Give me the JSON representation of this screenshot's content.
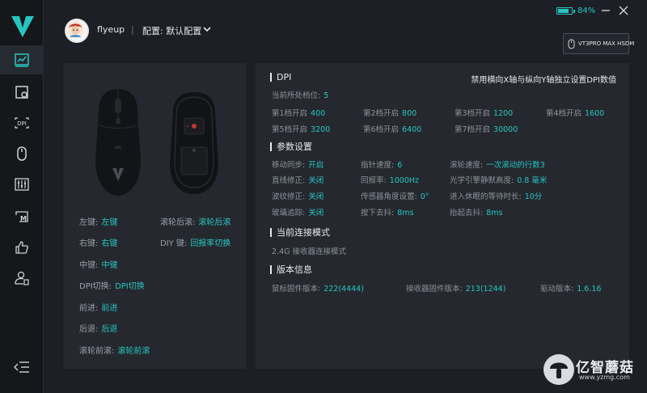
{
  "sidebar": {
    "items": [
      {
        "icon": "chart-icon",
        "active": true
      },
      {
        "icon": "macro-settings-icon",
        "active": false
      },
      {
        "icon": "dpi-icon",
        "label": "DPI",
        "active": false
      },
      {
        "icon": "mouse-icon",
        "active": false
      },
      {
        "icon": "equalizer-icon",
        "active": false
      },
      {
        "icon": "macro-m-icon",
        "label": "M",
        "active": false
      },
      {
        "icon": "thumbs-up-icon",
        "active": false
      },
      {
        "icon": "user-settings-icon",
        "active": false
      }
    ]
  },
  "header": {
    "username": "flyeup",
    "separator": "|",
    "profile": "配置: 默认配置",
    "battery": "84%",
    "battery_level": 0.84,
    "device": "VT3PRO MAX HSDM"
  },
  "left": {
    "mouse_logo": "VXE",
    "buttons": [
      {
        "key": "左键:",
        "value": "左键"
      },
      {
        "key": "右键:",
        "value": "右键"
      },
      {
        "key": "中键:",
        "value": "中键"
      },
      {
        "key": "DPI切换:",
        "value": "DPI切换"
      },
      {
        "key": "前进:",
        "value": "前进"
      },
      {
        "key": "后退:",
        "value": "后退"
      },
      {
        "key": "滚轮前滚:",
        "value": "滚轮前滚"
      },
      {
        "key": "滚轮后滚:",
        "value": "滚轮后滚"
      },
      {
        "key": "DIY 键:",
        "value": "回报率切换"
      }
    ]
  },
  "dpi": {
    "title": "DPI",
    "note": "禁用横向X轴与纵向Y轴独立设置DPI数值",
    "current_label": "当前所处档位:",
    "current_value": "5",
    "levels": [
      {
        "key": "第1档开启",
        "value": "400"
      },
      {
        "key": "第2档开启",
        "value": "800"
      },
      {
        "key": "第3档开启",
        "value": "1200"
      },
      {
        "key": "第4档开启",
        "value": "1600"
      },
      {
        "key": "第5档开启",
        "value": "3200"
      },
      {
        "key": "第6档开启",
        "value": "6400"
      },
      {
        "key": "第7档开启",
        "value": "30000"
      }
    ]
  },
  "params": {
    "title": "参数设置",
    "items": [
      {
        "key": "移动同步:",
        "value": "开启"
      },
      {
        "key": "指针速度:",
        "value": "6"
      },
      {
        "key": "滚轮速度:",
        "value": "一次滚动的行数3"
      },
      {
        "key": "直线修正:",
        "value": "关闭"
      },
      {
        "key": "回报率:",
        "value": "1000Hz"
      },
      {
        "key": "光学引擎静默高度:",
        "value": "0.8 毫米"
      },
      {
        "key": "波纹修正:",
        "value": "关闭"
      },
      {
        "key": "传感器角度设置:",
        "value": "0°"
      },
      {
        "key": "进入休眠的等待时长:",
        "value": "10分"
      },
      {
        "key": "玻璃追踪:",
        "value": "关闭"
      },
      {
        "key": "按下去抖:",
        "value": "8ms"
      },
      {
        "key": "抬起去抖:",
        "value": "8ms"
      }
    ]
  },
  "connection": {
    "title": "当前连接模式",
    "mode": "2.4G 接收器连接模式"
  },
  "version": {
    "title": "版本信息",
    "items": [
      {
        "key": "鼠标固件版本:",
        "value": "222(4444)"
      },
      {
        "key": "接收器固件版本:",
        "value": "213(1244)"
      },
      {
        "key": "驱动版本:",
        "value": "1.6.16"
      }
    ]
  },
  "watermark": {
    "name": "亿智蘑菇",
    "url": "www.yzmg.com"
  },
  "colors": {
    "accent": "#27c6c1",
    "panel": "#25282e",
    "background": "#1c1f25",
    "sidebar": "#15171b"
  }
}
